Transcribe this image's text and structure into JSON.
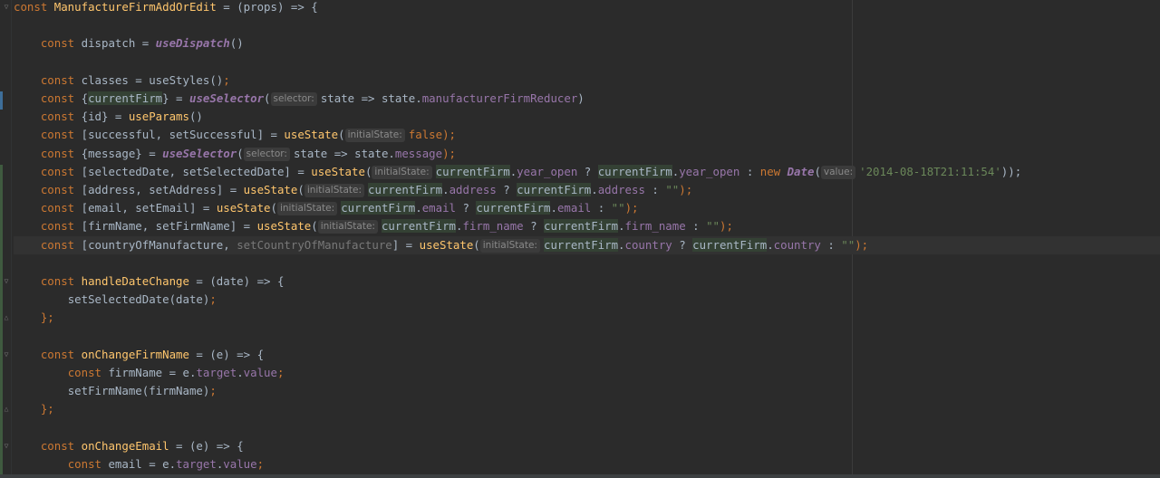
{
  "editor": {
    "lines": [
      [
        {
          "t": "const ",
          "c": "kw"
        },
        {
          "t": "ManufactureFirmAddOrEdit",
          "c": "fn"
        },
        {
          "t": " = (props) => {",
          "c": "plain"
        }
      ],
      [],
      [
        {
          "t": "    "
        },
        {
          "t": "const ",
          "c": "kw"
        },
        {
          "t": "dispatch = ",
          "c": "plain"
        },
        {
          "t": "useDispatch",
          "c": "it"
        },
        {
          "t": "()",
          "c": "plain"
        }
      ],
      [],
      [
        {
          "t": "    "
        },
        {
          "t": "const ",
          "c": "kw"
        },
        {
          "t": "classes = useStyles()",
          "c": "plain"
        },
        {
          "t": ";",
          "c": "kw"
        }
      ],
      [
        {
          "t": "    "
        },
        {
          "t": "const ",
          "c": "kw"
        },
        {
          "t": "{",
          "c": "plain"
        },
        {
          "t": "currentFirm",
          "c": "hl"
        },
        {
          "t": "} = ",
          "c": "plain"
        },
        {
          "t": "useSelector",
          "c": "it"
        },
        {
          "t": "(",
          "c": "plain"
        },
        {
          "hint": "selector:"
        },
        {
          "t": "state => state.",
          "c": "plain"
        },
        {
          "t": "manufacturerFirmReducer",
          "c": "prop"
        },
        {
          "t": ")",
          "c": "plain"
        }
      ],
      [
        {
          "t": "    "
        },
        {
          "t": "const ",
          "c": "kw"
        },
        {
          "t": "{id} = ",
          "c": "plain"
        },
        {
          "t": "useParams",
          "c": "fn"
        },
        {
          "t": "()",
          "c": "plain"
        }
      ],
      [
        {
          "t": "    "
        },
        {
          "t": "const ",
          "c": "kw"
        },
        {
          "t": "[successful, setSuccessful] = ",
          "c": "plain"
        },
        {
          "t": "useState",
          "c": "fn"
        },
        {
          "t": "(",
          "c": "plain"
        },
        {
          "hint": "initialState:"
        },
        {
          "t": "false",
          "c": "kw"
        },
        {
          "t": ");",
          "c": "kw"
        }
      ],
      [
        {
          "t": "    "
        },
        {
          "t": "const ",
          "c": "kw"
        },
        {
          "t": "{message} = ",
          "c": "plain"
        },
        {
          "t": "useSelector",
          "c": "it"
        },
        {
          "t": "(",
          "c": "plain"
        },
        {
          "hint": "selector:"
        },
        {
          "t": "state => state.",
          "c": "plain"
        },
        {
          "t": "message",
          "c": "prop"
        },
        {
          "t": ");",
          "c": "kw"
        }
      ],
      [
        {
          "t": "    "
        },
        {
          "t": "const ",
          "c": "kw"
        },
        {
          "t": "[selectedDate, setSelectedDate] = ",
          "c": "plain"
        },
        {
          "t": "useState",
          "c": "fn"
        },
        {
          "t": "(",
          "c": "plain"
        },
        {
          "hint": "initialState:"
        },
        {
          "t": "currentFirm",
          "c": "hl"
        },
        {
          "t": ".",
          "c": "plain"
        },
        {
          "t": "year_open",
          "c": "prop"
        },
        {
          "t": " ? ",
          "c": "plain"
        },
        {
          "t": "currentFirm",
          "c": "hl"
        },
        {
          "t": ".",
          "c": "plain"
        },
        {
          "t": "year_open",
          "c": "prop"
        },
        {
          "t": " : ",
          "c": "plain"
        },
        {
          "t": "new ",
          "c": "kw"
        },
        {
          "t": "Date",
          "c": "it"
        },
        {
          "t": "(",
          "c": "plain"
        },
        {
          "hint": "value:"
        },
        {
          "t": "'2014-08-18T21:11:54'",
          "c": "str"
        },
        {
          "t": "));",
          "c": "plain"
        }
      ],
      [
        {
          "t": "    "
        },
        {
          "t": "const ",
          "c": "kw"
        },
        {
          "t": "[address, setAddress] = ",
          "c": "plain"
        },
        {
          "t": "useState",
          "c": "fn"
        },
        {
          "t": "(",
          "c": "plain"
        },
        {
          "hint": "initialState:"
        },
        {
          "t": "currentFirm",
          "c": "hl"
        },
        {
          "t": ".",
          "c": "plain"
        },
        {
          "t": "address",
          "c": "prop"
        },
        {
          "t": " ? ",
          "c": "plain"
        },
        {
          "t": "currentFirm",
          "c": "hl"
        },
        {
          "t": ".",
          "c": "plain"
        },
        {
          "t": "address",
          "c": "prop"
        },
        {
          "t": " : ",
          "c": "plain"
        },
        {
          "t": "\"\"",
          "c": "str"
        },
        {
          "t": ");",
          "c": "kw"
        }
      ],
      [
        {
          "t": "    "
        },
        {
          "t": "const ",
          "c": "kw"
        },
        {
          "t": "[email, setEmail] = ",
          "c": "plain"
        },
        {
          "t": "useState",
          "c": "fn"
        },
        {
          "t": "(",
          "c": "plain"
        },
        {
          "hint": "initialState:"
        },
        {
          "t": "currentFirm",
          "c": "hl"
        },
        {
          "t": ".",
          "c": "plain"
        },
        {
          "t": "email",
          "c": "prop"
        },
        {
          "t": " ? ",
          "c": "plain"
        },
        {
          "t": "currentFirm",
          "c": "hl"
        },
        {
          "t": ".",
          "c": "plain"
        },
        {
          "t": "email",
          "c": "prop"
        },
        {
          "t": " : ",
          "c": "plain"
        },
        {
          "t": "\"\"",
          "c": "str"
        },
        {
          "t": ");",
          "c": "kw"
        }
      ],
      [
        {
          "t": "    "
        },
        {
          "t": "const ",
          "c": "kw"
        },
        {
          "t": "[firmName, setFirmName] = ",
          "c": "plain"
        },
        {
          "t": "useState",
          "c": "fn"
        },
        {
          "t": "(",
          "c": "plain"
        },
        {
          "hint": "initialState:"
        },
        {
          "t": "currentFirm",
          "c": "hl"
        },
        {
          "t": ".",
          "c": "plain"
        },
        {
          "t": "firm_name",
          "c": "prop"
        },
        {
          "t": " ? ",
          "c": "plain"
        },
        {
          "t": "currentFirm",
          "c": "hl"
        },
        {
          "t": ".",
          "c": "plain"
        },
        {
          "t": "firm_name",
          "c": "prop"
        },
        {
          "t": " : ",
          "c": "plain"
        },
        {
          "t": "\"\"",
          "c": "str"
        },
        {
          "t": ");",
          "c": "kw"
        }
      ],
      [
        {
          "t": "    "
        },
        {
          "t": "const ",
          "c": "kw"
        },
        {
          "t": "[countryOfManufacture, ",
          "c": "plain"
        },
        {
          "t": "setCountryOfManufacture",
          "c": "dim"
        },
        {
          "t": "] = ",
          "c": "plain"
        },
        {
          "t": "useState",
          "c": "fn"
        },
        {
          "t": "(",
          "c": "plain"
        },
        {
          "hint": "initialState:"
        },
        {
          "t": "currentFirm",
          "c": "hl"
        },
        {
          "t": ".",
          "c": "plain"
        },
        {
          "t": "country",
          "c": "prop"
        },
        {
          "t": " ? ",
          "c": "plain"
        },
        {
          "t": "currentFirm",
          "c": "hl"
        },
        {
          "t": ".",
          "c": "plain"
        },
        {
          "t": "country",
          "c": "prop"
        },
        {
          "t": " : ",
          "c": "plain"
        },
        {
          "t": "\"\"",
          "c": "str"
        },
        {
          "t": ");",
          "c": "kw"
        }
      ],
      [],
      [
        {
          "t": "    "
        },
        {
          "t": "const ",
          "c": "kw"
        },
        {
          "t": "handleDateChange",
          "c": "fn"
        },
        {
          "t": " = (date) => {",
          "c": "plain"
        }
      ],
      [
        {
          "t": "        "
        },
        {
          "t": "setSelectedDate(date)",
          "c": "plain"
        },
        {
          "t": ";",
          "c": "kw"
        }
      ],
      [
        {
          "t": "    "
        },
        {
          "t": "};",
          "c": "kw"
        }
      ],
      [],
      [
        {
          "t": "    "
        },
        {
          "t": "const ",
          "c": "kw"
        },
        {
          "t": "onChangeFirmName",
          "c": "fn"
        },
        {
          "t": " = (e) => {",
          "c": "plain"
        }
      ],
      [
        {
          "t": "        "
        },
        {
          "t": "const ",
          "c": "kw"
        },
        {
          "t": "firmName = e.",
          "c": "plain"
        },
        {
          "t": "target",
          "c": "prop"
        },
        {
          "t": ".",
          "c": "plain"
        },
        {
          "t": "value",
          "c": "prop"
        },
        {
          "t": ";",
          "c": "kw"
        }
      ],
      [
        {
          "t": "        "
        },
        {
          "t": "setFirmName(firmName)",
          "c": "plain"
        },
        {
          "t": ";",
          "c": "kw"
        }
      ],
      [
        {
          "t": "    "
        },
        {
          "t": "};",
          "c": "kw"
        }
      ],
      [],
      [
        {
          "t": "    "
        },
        {
          "t": "const ",
          "c": "kw"
        },
        {
          "t": "onChangeEmail",
          "c": "fn"
        },
        {
          "t": " = (e) => {",
          "c": "plain"
        }
      ],
      [
        {
          "t": "        "
        },
        {
          "t": "const ",
          "c": "kw"
        },
        {
          "t": "email = e.",
          "c": "plain"
        },
        {
          "t": "target",
          "c": "prop"
        },
        {
          "t": ".",
          "c": "plain"
        },
        {
          "t": "value",
          "c": "prop"
        },
        {
          "t": ";",
          "c": "kw"
        }
      ]
    ],
    "current_line": 13
  },
  "gutter": {
    "fold_icon_glyph": "▽",
    "fold_end_glyph": "△"
  }
}
